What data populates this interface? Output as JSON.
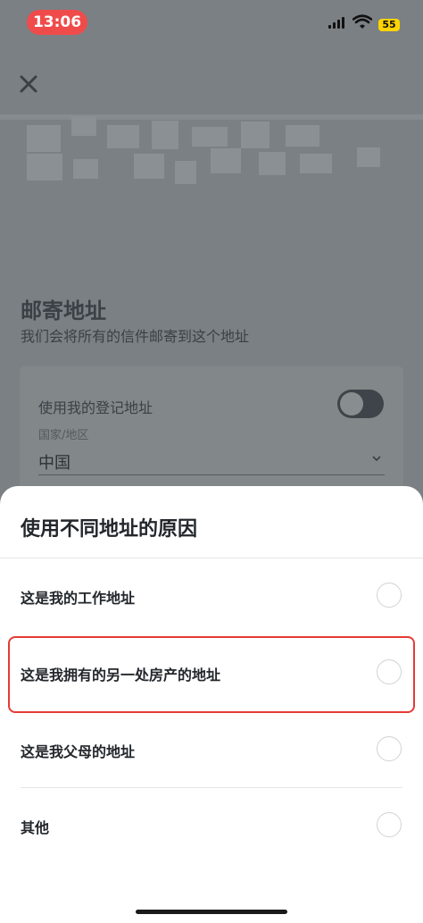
{
  "status_bar": {
    "time": "13:06",
    "battery": "55"
  },
  "background": {
    "section_title": "邮寄地址",
    "section_subtitle": "我们会将所有的信件邮寄到这个地址",
    "use_registered_label": "使用我的登记地址",
    "country_label": "国家/地区",
    "country_value": "中国"
  },
  "sheet": {
    "title": "使用不同地址的原因",
    "options": [
      {
        "label": "这是我的工作地址"
      },
      {
        "label": "这是我拥有的另一处房产的地址"
      },
      {
        "label": "这是我父母的地址"
      },
      {
        "label": "其他"
      }
    ]
  },
  "colors": {
    "highlight": "#e53b35",
    "time_pill": "#f04b4b",
    "battery": "#ffd400"
  }
}
